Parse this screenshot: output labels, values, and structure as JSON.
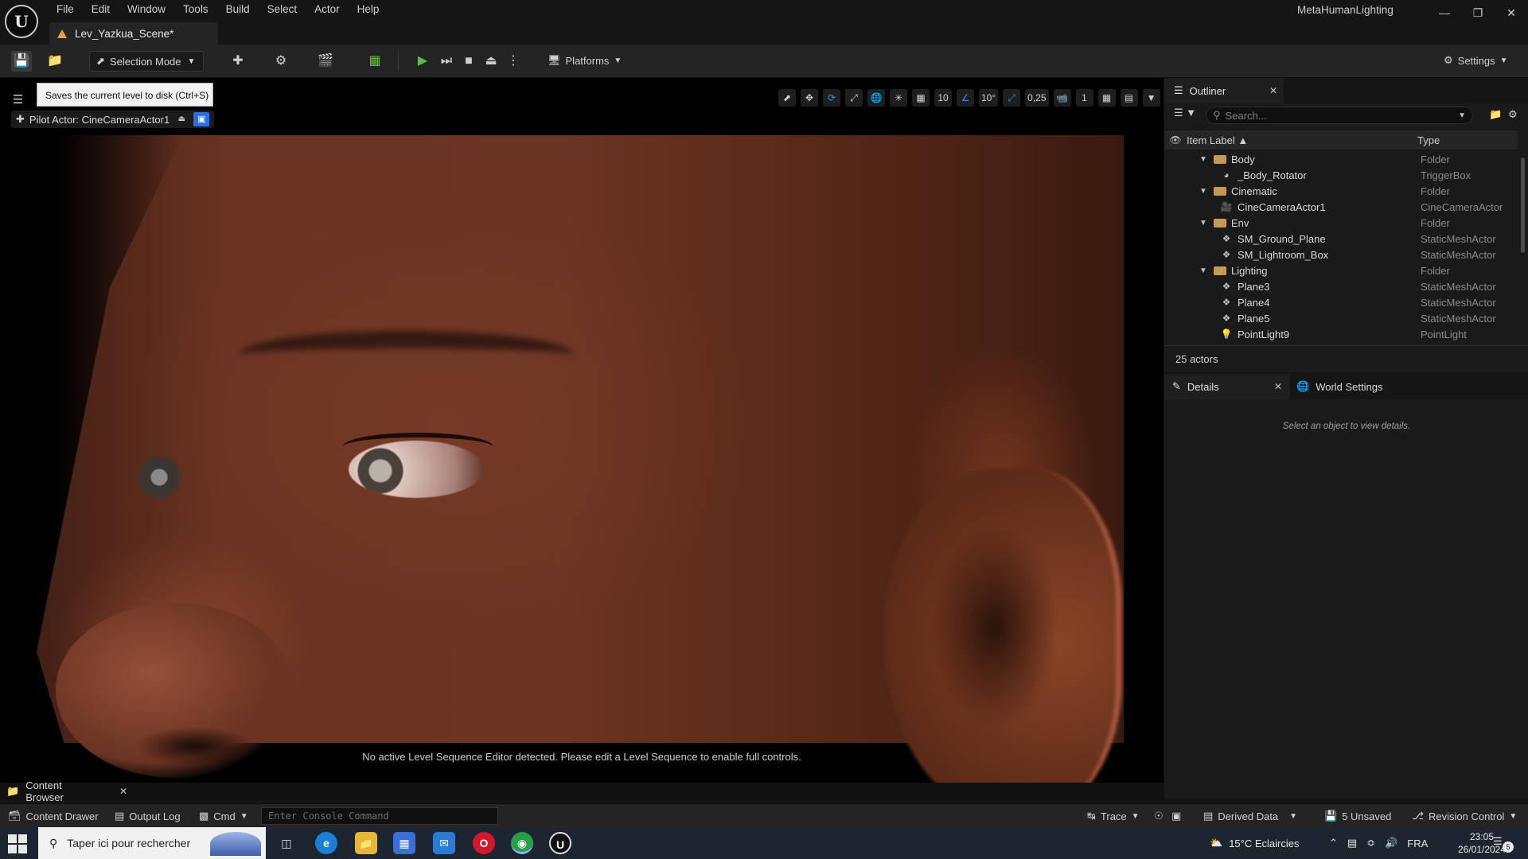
{
  "menu": [
    "File",
    "Edit",
    "Window",
    "Tools",
    "Build",
    "Select",
    "Actor",
    "Help"
  ],
  "level_tab": "Lev_Yazkua_Scene*",
  "app_title": "MetaHumanLighting",
  "toolbar": {
    "selection_mode": "Selection Mode",
    "platforms": "Platforms",
    "settings": "Settings"
  },
  "tooltip": "Saves the current level to disk (Ctrl+S)",
  "viewport": {
    "pilot_label": "Pilot Actor: CineCameraActor1",
    "grid_snap": "10",
    "rotation_snap": "10°",
    "scale_snap": "0,25",
    "camera_speed": "1",
    "sequence_message": "No active Level Sequence Editor detected. Please edit a Level Sequence to enable full controls."
  },
  "outliner": {
    "title": "Outliner",
    "search_placeholder": "Search...",
    "col_label": "Item Label",
    "col_type": "Type",
    "rows": [
      {
        "label": "Body",
        "type": "Folder"
      },
      {
        "label": "_Body_Rotator",
        "type": "TriggerBox"
      },
      {
        "label": "Cinematic",
        "type": "Folder"
      },
      {
        "label": "CineCameraActor1",
        "type": "CineCameraActor"
      },
      {
        "label": "Env",
        "type": "Folder"
      },
      {
        "label": "SM_Ground_Plane",
        "type": "StaticMeshActor"
      },
      {
        "label": "SM_Lightroom_Box",
        "type": "StaticMeshActor"
      },
      {
        "label": "Lighting",
        "type": "Folder"
      },
      {
        "label": "Plane3",
        "type": "StaticMeshActor"
      },
      {
        "label": "Plane4",
        "type": "StaticMeshActor"
      },
      {
        "label": "Plane5",
        "type": "StaticMeshActor"
      },
      {
        "label": "PointLight9",
        "type": "PointLight"
      }
    ],
    "actor_count": "25 actors"
  },
  "details": {
    "title": "Details",
    "world_settings": "World Settings",
    "empty_message": "Select an object to view details."
  },
  "bottom": {
    "content_browser": "Content Browser",
    "content_drawer": "Content Drawer",
    "output_log": "Output Log",
    "cmd": "Cmd",
    "console_placeholder": "Enter Console Command",
    "trace": "Trace",
    "derived_data": "Derived Data",
    "unsaved": "5 Unsaved",
    "revision_control": "Revision Control"
  },
  "taskbar": {
    "search_placeholder": "Taper ici pour rechercher",
    "weather": "15°C  Eclaircies",
    "language": "FRA",
    "time": "23:05",
    "date": "26/01/2024",
    "notifications": "5"
  }
}
